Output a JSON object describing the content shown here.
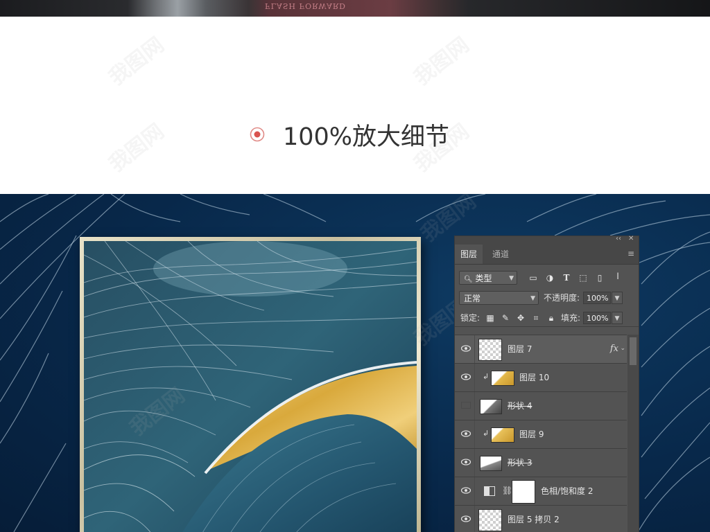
{
  "top_strip": {
    "book_text": "FLASH FORWARD"
  },
  "watermark": {
    "text": "我图网"
  },
  "section": {
    "title": "100%放大细节"
  },
  "colors": {
    "accent_target": "#d9534f",
    "panel_bg": "#535353",
    "art_bg": "#08284a"
  },
  "photoshop": {
    "tabs": [
      "图层",
      "通道"
    ],
    "filter": {
      "label": "类型"
    },
    "blend_mode": "正常",
    "opacity_label": "不透明度:",
    "opacity_value": "100%",
    "lock_label": "锁定:",
    "fill_label": "填充:",
    "fill_value": "100%",
    "filter_icons": [
      "image-filter-icon",
      "adjustment-filter-icon",
      "type-filter-icon",
      "shape-filter-icon",
      "smart-object-filter-icon",
      "filter-toggle-icon"
    ],
    "lock_icons": [
      "lock-transparent-icon",
      "lock-paint-icon",
      "lock-position-icon",
      "lock-artboard-icon",
      "lock-all-icon"
    ],
    "layers": [
      {
        "name": "图层 7",
        "visible": true,
        "fx": "fx",
        "clipped": false
      },
      {
        "name": "图层 10",
        "visible": true,
        "clipped": true
      },
      {
        "name": "形状 4",
        "visible": false,
        "shape": true
      },
      {
        "name": "图层 9",
        "visible": true,
        "clipped": true
      },
      {
        "name": "形状 3",
        "visible": true,
        "shape": true
      },
      {
        "name": "色相/饱和度 2",
        "visible": true,
        "adjustment": true
      },
      {
        "name": "图层 5 拷贝 2",
        "visible": true
      }
    ]
  }
}
